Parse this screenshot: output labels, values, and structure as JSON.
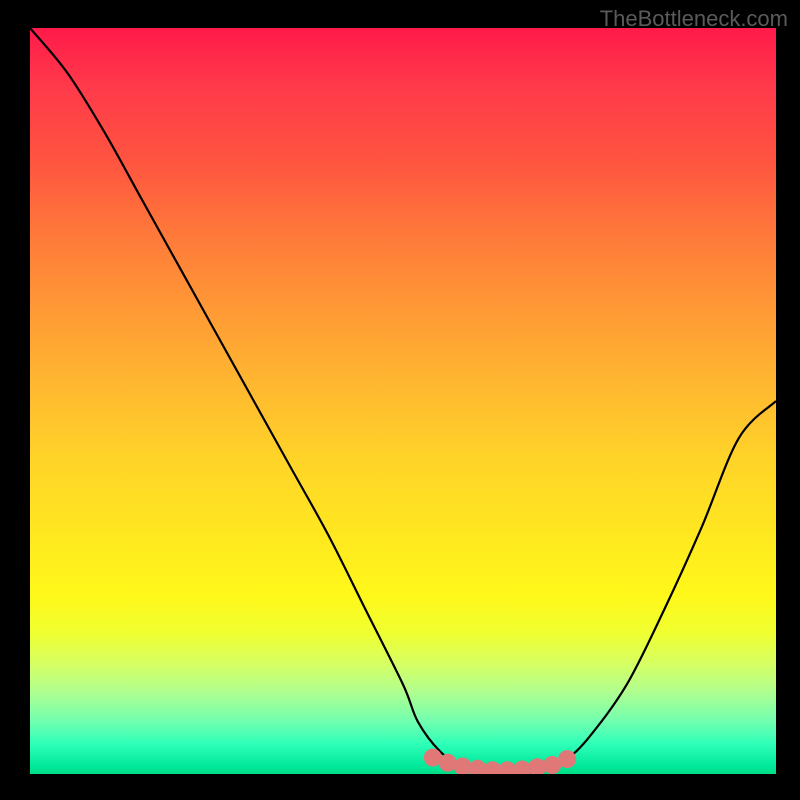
{
  "watermark": "TheBottleneck.com",
  "chart_data": {
    "type": "line",
    "title": "",
    "xlabel": "",
    "ylabel": "",
    "xlim": [
      0,
      100
    ],
    "ylim": [
      0,
      100
    ],
    "series": [
      {
        "name": "curve",
        "color": "#000000",
        "x": [
          0,
          5,
          10,
          15,
          20,
          25,
          30,
          35,
          40,
          45,
          50,
          52,
          55,
          58,
          62,
          66,
          70,
          72,
          75,
          80,
          85,
          90,
          95,
          100
        ],
        "y": [
          100,
          94,
          86,
          77,
          68,
          59,
          50,
          41,
          32,
          22,
          12,
          7,
          3,
          1,
          0,
          0,
          1,
          2,
          5,
          12,
          22,
          33,
          45,
          50
        ]
      }
    ],
    "markers": {
      "name": "bottom-dots",
      "color": "#e07878",
      "points": [
        {
          "x": 54,
          "y": 2.2
        },
        {
          "x": 56,
          "y": 1.5
        },
        {
          "x": 58,
          "y": 1.0
        },
        {
          "x": 60,
          "y": 0.7
        },
        {
          "x": 62,
          "y": 0.5
        },
        {
          "x": 64,
          "y": 0.5
        },
        {
          "x": 66,
          "y": 0.6
        },
        {
          "x": 68,
          "y": 0.9
        },
        {
          "x": 70,
          "y": 1.2
        },
        {
          "x": 72,
          "y": 2.0
        }
      ]
    },
    "gradient_stops": [
      {
        "pos": 0.0,
        "color": "#ff1a4a"
      },
      {
        "pos": 0.5,
        "color": "#ffd428"
      },
      {
        "pos": 0.8,
        "color": "#f0ff30"
      },
      {
        "pos": 1.0,
        "color": "#00dc82"
      }
    ]
  }
}
